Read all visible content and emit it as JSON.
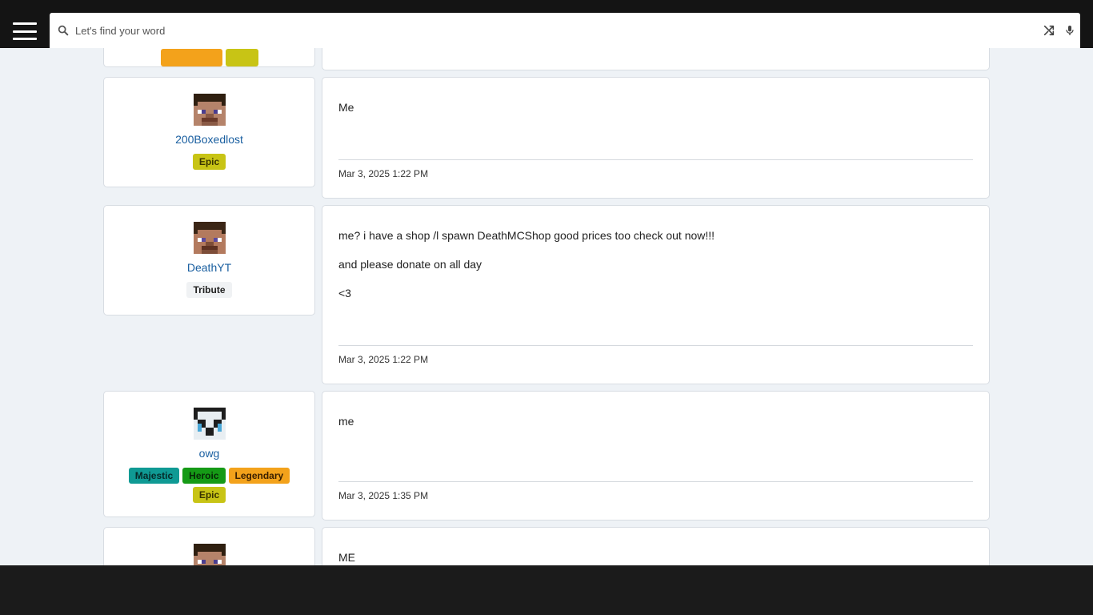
{
  "search": {
    "placeholder": "Let's find your word"
  },
  "header": {
    "menu_icon": "hamburger-menu-icon",
    "search_icon": "search-icon",
    "shuffle_icon": "shuffle-icon",
    "mic_icon": "microphone-icon"
  },
  "colors": {
    "topbar": "#141414",
    "page_bg": "#eef2f6",
    "link": "#1a5fa0",
    "epic": "#c8c415",
    "majestic": "#0f9a94",
    "heroic": "#159a16",
    "legendary": "#f3a21b",
    "tribute": "#f0f2f4"
  },
  "posts": [
    {
      "username": "200Boxedlost",
      "badges": [
        "Epic"
      ],
      "paragraphs": [
        "Me"
      ],
      "timestamp": "Mar 3, 2025 1:22 PM"
    },
    {
      "username": "DeathYT",
      "badges": [
        "Tribute"
      ],
      "paragraphs": [
        "me? i have a shop /l spawn DeathMCShop good prices too check out now!!!",
        "and please donate on all day",
        "<3"
      ],
      "timestamp": "Mar 3, 2025 1:22 PM"
    },
    {
      "username": "owg",
      "badges": [
        "Majestic",
        "Heroic",
        "Legendary",
        "Epic"
      ],
      "paragraphs": [
        "me"
      ],
      "timestamp": "Mar 3, 2025 1:35 PM"
    },
    {
      "paragraphs": [
        "ME"
      ]
    }
  ]
}
